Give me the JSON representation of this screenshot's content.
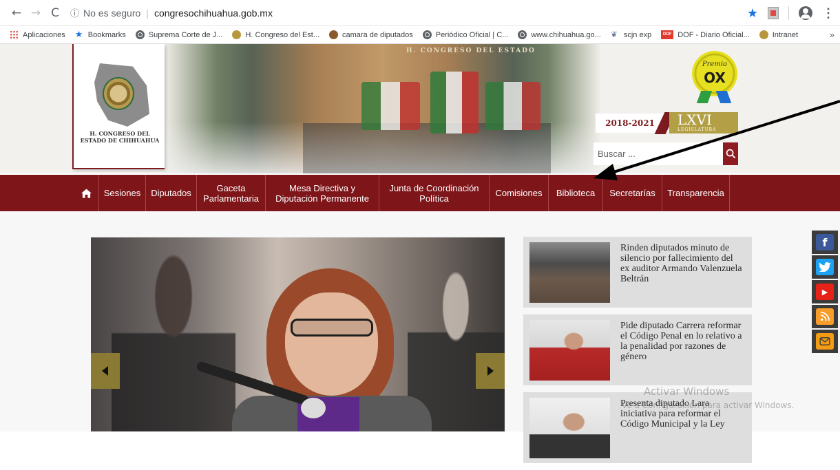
{
  "browser": {
    "back_icon": "←",
    "forward_icon": "→",
    "reload_icon": "C",
    "security_label": "No es seguro",
    "url": "congresochihuahua.gob.mx",
    "bookmark_star_icon": "★",
    "menu_icon": "⋮"
  },
  "bookmarks": [
    {
      "label": "Aplicaciones",
      "icon": "apps-icon"
    },
    {
      "label": "Bookmarks",
      "icon": "star-icon"
    },
    {
      "label": "Suprema Corte de J...",
      "icon": "globe-icon"
    },
    {
      "label": "H. Congreso del Est...",
      "icon": "seal-icon"
    },
    {
      "label": "camara de diputados",
      "icon": "camara-icon"
    },
    {
      "label": "Periódico Oficial | C...",
      "icon": "globe-icon"
    },
    {
      "label": "www.chihuahua.go...",
      "icon": "globe-icon"
    },
    {
      "label": "scjn exp",
      "icon": "scjn-icon"
    },
    {
      "label": "DOF - Diario Oficial...",
      "icon": "dof-icon"
    },
    {
      "label": "Intranet",
      "icon": "seal-icon"
    }
  ],
  "bookmarks_more": "»",
  "header": {
    "hero_caption": "H. CONGRESO DEL ESTADO",
    "logo_text": "H. CONGRESO DEL ESTADO DE CHIHUAHUA",
    "premio_label": "Premio",
    "premio_ox": "OX",
    "legislature_years": "2018-2021",
    "legislature_roman": "LXVI",
    "legislature_sub": "LEGISLATURA",
    "search_placeholder": "Buscar ..."
  },
  "nav": {
    "items": [
      {
        "label": "Sesiones"
      },
      {
        "label": "Diputados"
      },
      {
        "label": "Gaceta Parlamentaria"
      },
      {
        "label": "Mesa Directiva y Diputación Permanente"
      },
      {
        "label": "Junta de Coordinación Política"
      },
      {
        "label": "Comisiones"
      },
      {
        "label": "Biblioteca"
      },
      {
        "label": "Secretarías"
      },
      {
        "label": "Transparencia"
      }
    ]
  },
  "news": [
    {
      "title": "Rinden diputados minuto de silencio por fallecimiento del ex auditor Armando Valenzuela Beltrán"
    },
    {
      "title": "Pide diputado Carrera reformar el Código Penal en lo relativo a la penalidad por razones de género"
    },
    {
      "title": "Presenta diputado Lara iniciativa para reformar el Código Municipal y la Ley"
    }
  ],
  "social": {
    "facebook": "f",
    "twitter": "t",
    "youtube": "▶",
    "rss": "rss",
    "mail": "✉"
  },
  "watermark": {
    "title": "Activar Windows",
    "subtitle": "Ve a Configuración para activar Windows."
  },
  "colors": {
    "nav_bg": "#7d1519",
    "accent_gold": "#b3a046",
    "search_btn": "#8e1a22"
  }
}
